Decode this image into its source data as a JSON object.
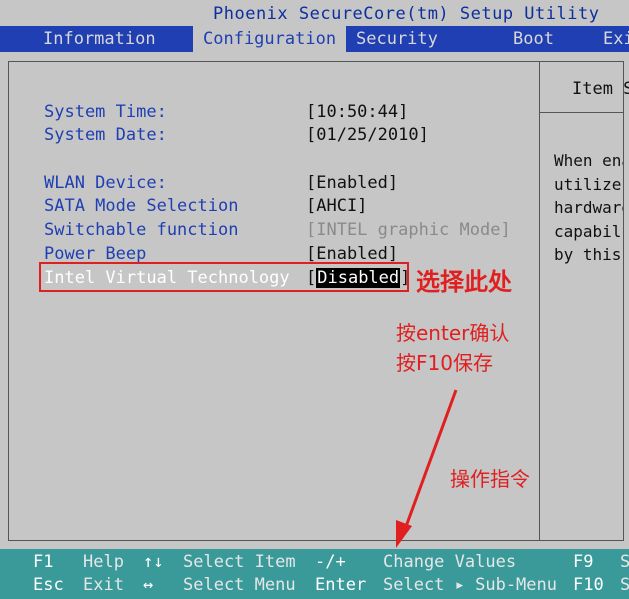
{
  "title": "Phoenix SecureCore(tm) Setup Utility",
  "menu": [
    "Information",
    "Configuration",
    "Security",
    "Boot",
    "Exi"
  ],
  "active_menu": 1,
  "settings": [
    {
      "label": "System Time:",
      "value": "[10:50:44]"
    },
    {
      "label": "System Date:",
      "value": "[01/25/2010]"
    },
    {
      "label": "WLAN Device:",
      "value": "[Enabled]"
    },
    {
      "label": "SATA Mode Selection",
      "value": "[AHCI]"
    },
    {
      "label": "Switchable function",
      "value": "[INTEL graphic Mode]"
    },
    {
      "label": "Power Beep",
      "value": "[Enabled]"
    },
    {
      "label": "Intel Virtual Technology",
      "value_open": "[",
      "value_selected": "Disabled",
      "value_close": "]"
    }
  ],
  "help": {
    "title": "Item S",
    "lines": [
      "When ena",
      "utilize",
      "hardware",
      "capabil",
      "by this"
    ]
  },
  "annotations": {
    "select_here": "选择此处",
    "press_enter": "按enter确认",
    "press_f10": "按F10保存",
    "instructions": "操作指令"
  },
  "keys": {
    "row1": [
      {
        "key": "F1",
        "desc": "Help"
      },
      {
        "key": "↑↓",
        "desc": "Select Item"
      },
      {
        "key": "-/+",
        "desc": "Change Values"
      },
      {
        "key": "F9",
        "desc": "S"
      }
    ],
    "row2": [
      {
        "key": "Esc",
        "desc": "Exit"
      },
      {
        "key": "↔",
        "desc": "Select Menu"
      },
      {
        "key": "Enter",
        "desc": "Select ▸ Sub-Menu"
      },
      {
        "key": "F10",
        "desc": "S"
      }
    ]
  },
  "colors": {
    "bios_blue": "#1f3fb3",
    "bios_gray": "#c6c6c6",
    "keybar_teal": "#3a9a9a",
    "annotation_red": "#e02020"
  }
}
